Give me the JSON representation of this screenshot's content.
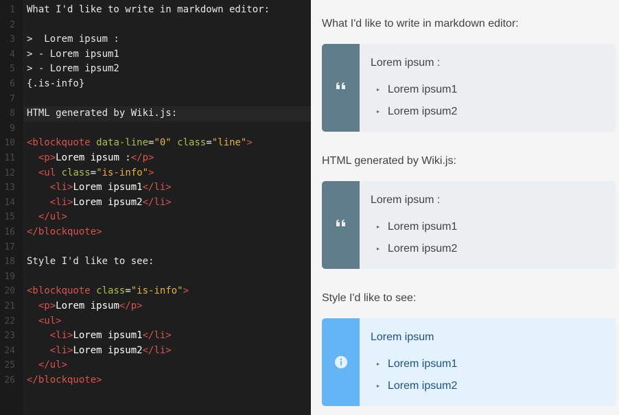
{
  "editor": {
    "line_numbers": [
      "1",
      "2",
      "3",
      "4",
      "5",
      "6",
      "7",
      "8",
      "9",
      "10",
      "11",
      "12",
      "13",
      "14",
      "15",
      "16",
      "17",
      "18",
      "19",
      "20",
      "21",
      "22",
      "23",
      "24",
      "25",
      "26"
    ],
    "lines": {
      "l1": "What I'd like to write in markdown editor:",
      "l3": ">  Lorem ipsum :",
      "l4": "> - Lorem ipsum1",
      "l5": "> - Lorem ipsum2",
      "l6": "{.is-info}",
      "l8": "HTML generated by Wiki.js:",
      "l18": "Style I'd like to see:"
    },
    "code": {
      "bq_open": "<blockquote",
      "attr_data_line": "data-line",
      "eq": "=",
      "val_zero": "\"0\"",
      "attr_class": "class",
      "val_line": "\"line\"",
      "close": ">",
      "p_open": "<p>",
      "p_close": "</p>",
      "ul_open_start": "<ul",
      "val_is_info": "\"is-info\"",
      "ul_plain": "<ul>",
      "li_open": "<li>",
      "li_close": "</li>",
      "ul_close": "</ul>",
      "bq_close": "</blockquote>",
      "lorem_colon": "Lorem ipsum :",
      "lorem": "Lorem ipsum",
      "lorem1": "Lorem ipsum1",
      "lorem2": "Lorem ipsum2"
    }
  },
  "preview": {
    "heading1": "What I'd like to write in markdown editor:",
    "heading2": "HTML generated by Wiki.js:",
    "heading3": "Style I'd like to see:",
    "block1": {
      "title": "Lorem ipsum :",
      "items": [
        "Lorem ipsum1",
        "Lorem ipsum2"
      ],
      "icon": "quote-icon"
    },
    "block2": {
      "title": "Lorem ipsum :",
      "items": [
        "Lorem ipsum1",
        "Lorem ipsum2"
      ],
      "icon": "quote-icon"
    },
    "block3": {
      "title": "Lorem ipsum",
      "items": [
        "Lorem ipsum1",
        "Lorem ipsum2"
      ],
      "icon": "info-icon"
    },
    "bullet": "▸"
  },
  "colors": {
    "editor_bg": "#1e1e1e",
    "tag": "#d9534f",
    "attr": "#a6c24b",
    "string": "#e3b341",
    "quote_bar": "#607d8b",
    "quote_bg": "#eceff1",
    "info_bar": "#64b5f6",
    "info_bg": "#e3f2fd"
  }
}
